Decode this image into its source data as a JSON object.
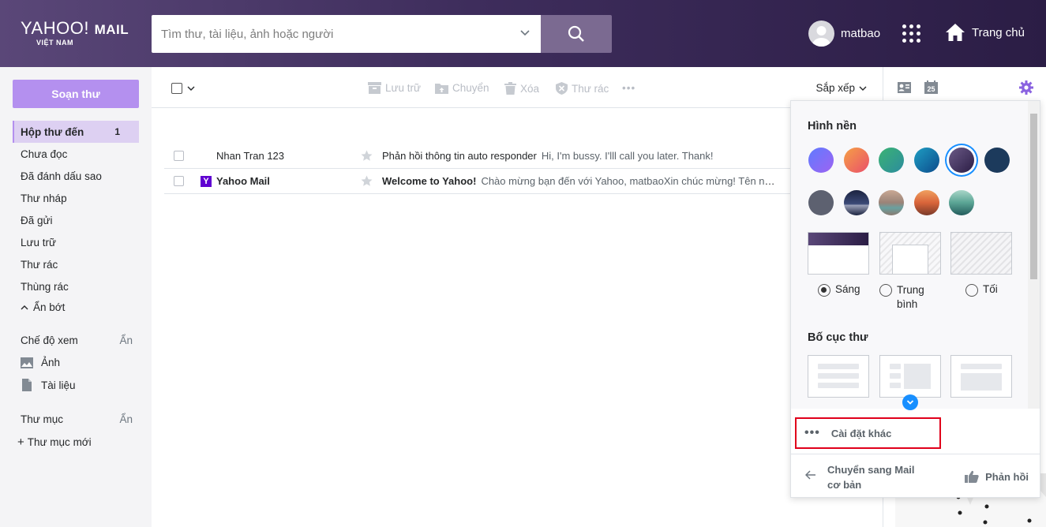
{
  "header": {
    "logo_line1": "YAHOO!",
    "logo_line1b": "MAIL",
    "logo_line2": "VIỆT NAM",
    "search_placeholder": "Tìm thư, tài liệu, ảnh hoặc người",
    "username": "matbao",
    "home_label": "Trang chủ"
  },
  "sidebar": {
    "compose_label": "Soạn thư",
    "folders": [
      {
        "label": "Hộp thư đến",
        "count": "1"
      },
      {
        "label": "Chưa đọc"
      },
      {
        "label": "Đã đánh dấu sao"
      },
      {
        "label": "Thư nháp"
      },
      {
        "label": "Đã gửi"
      },
      {
        "label": "Lưu trữ"
      },
      {
        "label": "Thư rác"
      },
      {
        "label": "Thùng rác"
      }
    ],
    "collapse_label": "Ẩn bớt",
    "views_label": "Chế độ xem",
    "views_hide": "Ẩn",
    "photos_label": "Ảnh",
    "docs_label": "Tài liệu",
    "folders_label": "Thư mục",
    "folders_hide": "Ẩn",
    "new_folder_label": "Thư mục mới"
  },
  "toolbar": {
    "archive": "Lưu trữ",
    "move": "Chuyển",
    "delete": "Xóa",
    "spam": "Thư rác",
    "more": "•••",
    "sort": "Sắp xếp"
  },
  "messages": [
    {
      "sender": "Nhan Tran 123",
      "subject": "Phản hồi thông tin auto responder",
      "preview": "Hi, I'm bussy. I'lll call you later. Thank!",
      "unread": false
    },
    {
      "sender": "Yahoo Mail",
      "subject": "Welcome to Yahoo!",
      "preview": "Chào mừng bạn đến với Yahoo, matbaoXin chúc mừng! Tên ng...",
      "unread": true
    }
  ],
  "settings_panel": {
    "theme_title": "Hình nền",
    "theme_colors": [
      "#7a6ff7",
      "#f0743e",
      "#2fa36a",
      "#0f6fb0",
      "#3e2d5c",
      "#1c3a5c"
    ],
    "theme_images": [
      "#5d6170",
      "#2b3350",
      "#b39a8a",
      "#d97a3e",
      "#3f8f86"
    ],
    "mode_light": "Sáng",
    "mode_medium": "Trung bình",
    "mode_dark": "Tối",
    "layout_title": "Bố cục thư",
    "more_settings": "Cài đặt khác",
    "switch_basic": "Chuyển sang Mail cơ bản",
    "feedback": "Phản hồi"
  },
  "colors": {
    "accent": "#b490ef",
    "header_bg": "#3e2d5c",
    "selected_swatch_border": "#188fff",
    "highlight_box": "#e0001b"
  }
}
